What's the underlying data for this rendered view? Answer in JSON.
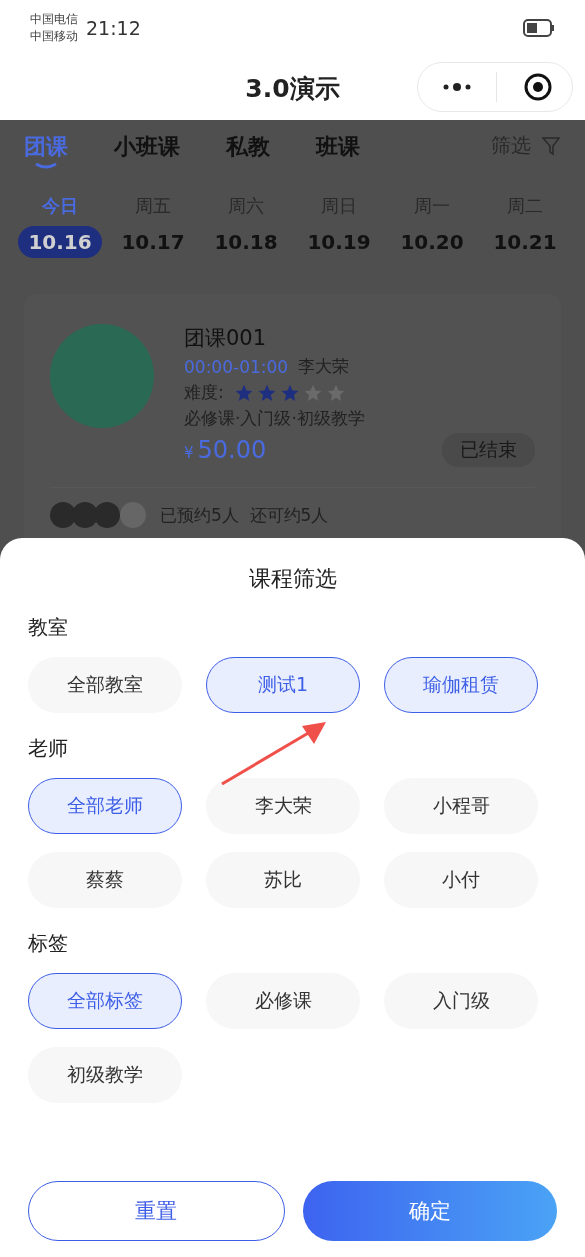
{
  "status_bar": {
    "carriers": [
      "中国电信",
      "中国移动"
    ],
    "time": "21:12"
  },
  "nav": {
    "title": "3.0演示"
  },
  "tabs": [
    {
      "label": "团课",
      "selected": true
    },
    {
      "label": "小班课",
      "selected": false
    },
    {
      "label": "私教",
      "selected": false
    },
    {
      "label": "班课",
      "selected": false
    }
  ],
  "filter_label": "筛选",
  "days": [
    {
      "weekday": "今日",
      "date": "10.16",
      "selected": true
    },
    {
      "weekday": "周五",
      "date": "10.17",
      "selected": false
    },
    {
      "weekday": "周六",
      "date": "10.18",
      "selected": false
    },
    {
      "weekday": "周日",
      "date": "10.19",
      "selected": false
    },
    {
      "weekday": "周一",
      "date": "10.20",
      "selected": false
    },
    {
      "weekday": "周二",
      "date": "10.21",
      "selected": false
    }
  ],
  "course": {
    "name": "团课001",
    "time": "00:00-01:00",
    "teacher": "李大荣",
    "difficulty_label": "难度:",
    "stars": 3,
    "tags": "必修课·入门级·初级教学",
    "currency": "¥",
    "price": "50.00",
    "status": "已结束",
    "booking": "已预约5人  还可约5人"
  },
  "sheet": {
    "title": "课程筛选",
    "groups": [
      {
        "label": "教室",
        "options": [
          {
            "label": "全部教室",
            "selected": false
          },
          {
            "label": "测试1",
            "selected": true
          },
          {
            "label": "瑜伽租赁",
            "selected": true
          }
        ]
      },
      {
        "label": "老师",
        "options": [
          {
            "label": "全部老师",
            "selected": true
          },
          {
            "label": "李大荣",
            "selected": false
          },
          {
            "label": "小程哥",
            "selected": false
          },
          {
            "label": "蔡蔡",
            "selected": false
          },
          {
            "label": "苏比",
            "selected": false
          },
          {
            "label": "小付",
            "selected": false
          }
        ]
      },
      {
        "label": "标签",
        "options": [
          {
            "label": "全部标签",
            "selected": true
          },
          {
            "label": "必修课",
            "selected": false
          },
          {
            "label": "入门级",
            "selected": false
          },
          {
            "label": "初级教学",
            "selected": false
          }
        ]
      }
    ],
    "buttons": [
      {
        "label": "重置",
        "kind": "secondary"
      },
      {
        "label": "确定",
        "kind": "primary"
      }
    ]
  }
}
